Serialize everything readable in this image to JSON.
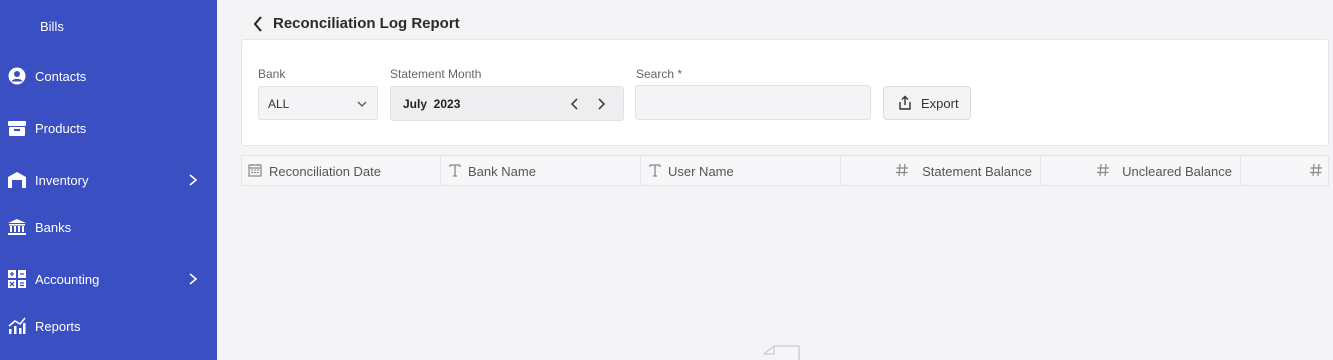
{
  "sidebar": {
    "items": [
      {
        "label": "Bills",
        "icon": "bills"
      },
      {
        "label": "Contacts",
        "icon": "contact-icon"
      },
      {
        "label": "Products",
        "icon": "box-icon"
      },
      {
        "label": "Inventory",
        "icon": "warehouse-icon",
        "has_submenu": true
      },
      {
        "label": "Banks",
        "icon": "bank-icon"
      },
      {
        "label": "Accounting",
        "icon": "calculator-icon",
        "has_submenu": true
      },
      {
        "label": "Reports",
        "icon": "chart-icon"
      }
    ]
  },
  "page": {
    "title": "Reconciliation Log Report"
  },
  "filters": {
    "bank_label": "Bank",
    "bank_value": "ALL",
    "month_label": "Statement Month",
    "month_value": "July  2023",
    "search_label": "Search *",
    "search_value": "",
    "export_label": "Export"
  },
  "table": {
    "columns": [
      {
        "label": "Reconciliation Date",
        "type": "date",
        "icon": "calendar-icon"
      },
      {
        "label": "Bank Name",
        "type": "text",
        "icon": "text-type-icon"
      },
      {
        "label": "User Name",
        "type": "text",
        "icon": "text-type-icon"
      },
      {
        "label": "Statement Balance",
        "type": "number",
        "icon": "hash-icon"
      },
      {
        "label": "Uncleared Balance",
        "type": "number",
        "icon": "hash-icon"
      },
      {
        "label": "",
        "type": "number",
        "icon": "hash-icon"
      }
    ],
    "rows": []
  },
  "colors": {
    "sidebar_bg": "#3a4fc1",
    "page_bg": "#f4f4f6"
  }
}
